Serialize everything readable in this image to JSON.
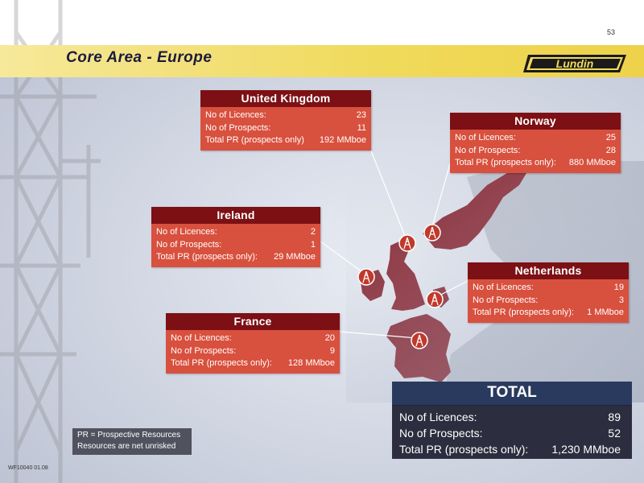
{
  "page_number": "53",
  "title": "Core Area - Europe",
  "logo_text": "Lundin",
  "colors": {
    "header_yellow": "#f0da5a",
    "card_header": "#7c1014",
    "card_body": "#d8503e",
    "total_bg": "#2c2e3f",
    "map_land": "#8a2a35"
  },
  "countries": [
    {
      "name": "United Kingdom",
      "rows": [
        {
          "label": "No of Licences:",
          "value": "23"
        },
        {
          "label": "No of Prospects:",
          "value": "11"
        },
        {
          "label": "Total PR (prospects only)",
          "value": "192 MMboe"
        }
      ]
    },
    {
      "name": "Norway",
      "rows": [
        {
          "label": "No of Licences:",
          "value": "25"
        },
        {
          "label": "No of Prospects:",
          "value": "28"
        },
        {
          "label": "Total PR (prospects only):",
          "value": "880 MMboe"
        }
      ]
    },
    {
      "name": "Ireland",
      "rows": [
        {
          "label": "No of Licences:",
          "value": "2"
        },
        {
          "label": "No of Prospects:",
          "value": "1"
        },
        {
          "label": "Total PR (prospects only):",
          "value": "29 MMboe"
        }
      ]
    },
    {
      "name": "Netherlands",
      "rows": [
        {
          "label": "No of Licences:",
          "value": "19"
        },
        {
          "label": "No of Prospects:",
          "value": "3"
        },
        {
          "label": "Total PR (prospects only):",
          "value": "1 MMboe"
        }
      ]
    },
    {
      "name": "France",
      "rows": [
        {
          "label": "No of Licences:",
          "value": "20"
        },
        {
          "label": "No of Prospects:",
          "value": "9"
        },
        {
          "label": "Total PR (prospects only):",
          "value": "128 MMboe"
        }
      ]
    }
  ],
  "total": {
    "heading": "TOTAL",
    "rows": [
      {
        "label": "No of Licences:",
        "value": "89"
      },
      {
        "label": "No of Prospects:",
        "value": "52"
      },
      {
        "label": "Total PR (prospects only):",
        "value": "1,230 MMboe"
      }
    ]
  },
  "legend": {
    "line1": "PR = Prospective Resources",
    "line2": "Resources are net unrisked"
  },
  "footer_code": "WF10040 01.08",
  "icons": [
    "oil-rig-icon",
    "map-pin-rig-icon",
    "lundin-logo"
  ]
}
